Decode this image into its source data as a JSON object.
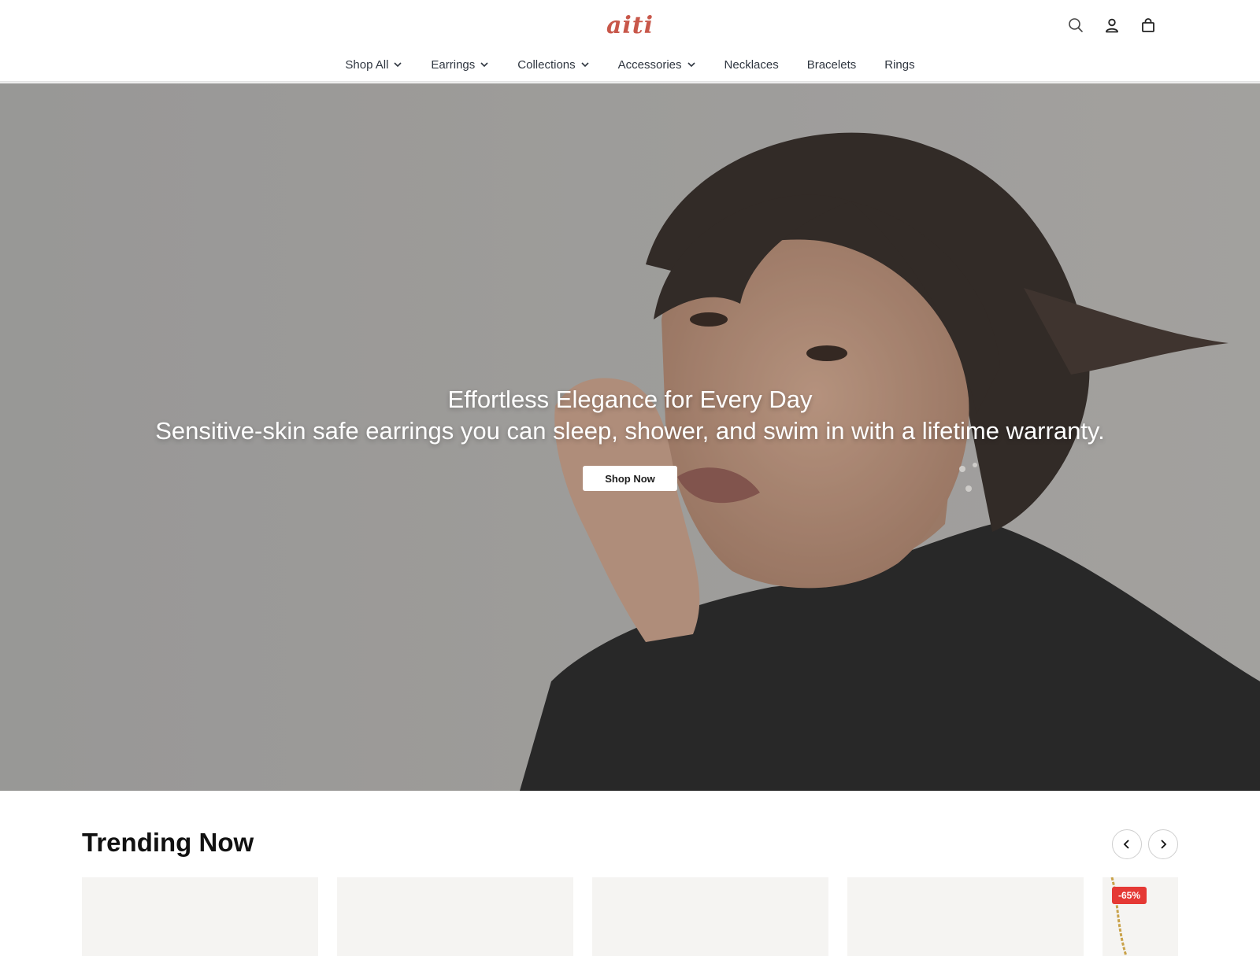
{
  "brand": {
    "logo_text": "aiti",
    "logo_color": "#c8574a"
  },
  "header": {
    "icons": [
      "search-icon",
      "account-icon",
      "cart-icon"
    ]
  },
  "nav": {
    "items": [
      {
        "label": "Shop All",
        "dropdown": true
      },
      {
        "label": "Earrings",
        "dropdown": true
      },
      {
        "label": "Collections",
        "dropdown": true
      },
      {
        "label": "Accessories",
        "dropdown": true
      },
      {
        "label": "Necklaces",
        "dropdown": false
      },
      {
        "label": "Bracelets",
        "dropdown": false
      },
      {
        "label": "Rings",
        "dropdown": false
      }
    ]
  },
  "hero": {
    "title": "Effortless Elegance for Every Day",
    "subtitle": "Sensitive-skin safe earrings you can sleep, shower, and swim in with a lifetime warranty.",
    "cta_label": "Shop Now"
  },
  "trending": {
    "title": "Trending Now",
    "prev_icon": "chevron-left-icon",
    "next_icon": "chevron-right-icon",
    "cards": [
      {
        "badge": ""
      },
      {
        "badge": ""
      },
      {
        "badge": ""
      },
      {
        "badge": ""
      },
      {
        "badge": "-65%"
      }
    ]
  },
  "colors": {
    "accent": "#c8574a",
    "badge": "#e53935",
    "nav_text": "#2f3640"
  }
}
